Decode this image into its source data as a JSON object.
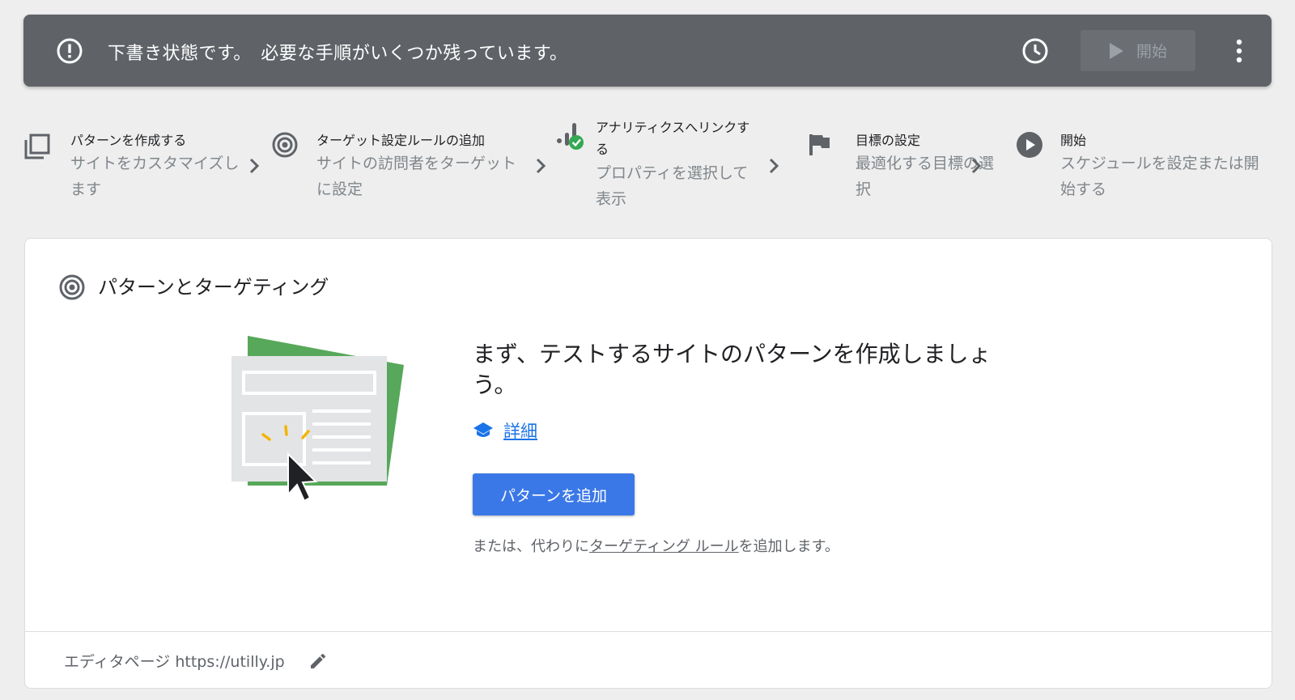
{
  "banner": {
    "message": "下書き状態です。　必要な手順がいくつか残っています。",
    "start_label": "開始",
    "icons": {
      "alert": "alert-circle-icon",
      "schedule": "clock-icon",
      "more": "more-vert-icon",
      "play": "play-icon"
    }
  },
  "steps": [
    {
      "title": "パターンを作成する",
      "desc": "サイトをカスタマイズします",
      "icon": "variants-icon"
    },
    {
      "title": "ターゲット設定ルールの追加",
      "desc": "サイトの訪問者をターゲットに設定",
      "icon": "target-icon"
    },
    {
      "title": "アナリティクスへリンクする",
      "desc": "プロパティを選択して表示",
      "icon": "analytics-check-icon"
    },
    {
      "title": "目標の設定",
      "desc": "最適化する目標の選択",
      "icon": "flag-icon"
    },
    {
      "title": "開始",
      "desc": "スケジュールを設定または開始する",
      "icon": "play-circle-icon"
    }
  ],
  "card": {
    "title": "パターンとターゲティング",
    "heading": "まず、テストするサイトのパターンを作成しましょう。",
    "learn_more": "詳細",
    "add_button": "パターンを追加",
    "alt_prefix": "または、代わりに",
    "alt_link": "ターゲティング ルール",
    "alt_suffix": "を追加します。",
    "editor_label": "エディタページ https://utilly.jp"
  },
  "colors": {
    "banner_bg": "#5f6368",
    "accent_blue": "#3b78e7",
    "link_blue": "#1a73e8",
    "success_green": "#34a853",
    "illustration_green": "#57a85a",
    "illustration_yellow": "#f4b400"
  }
}
